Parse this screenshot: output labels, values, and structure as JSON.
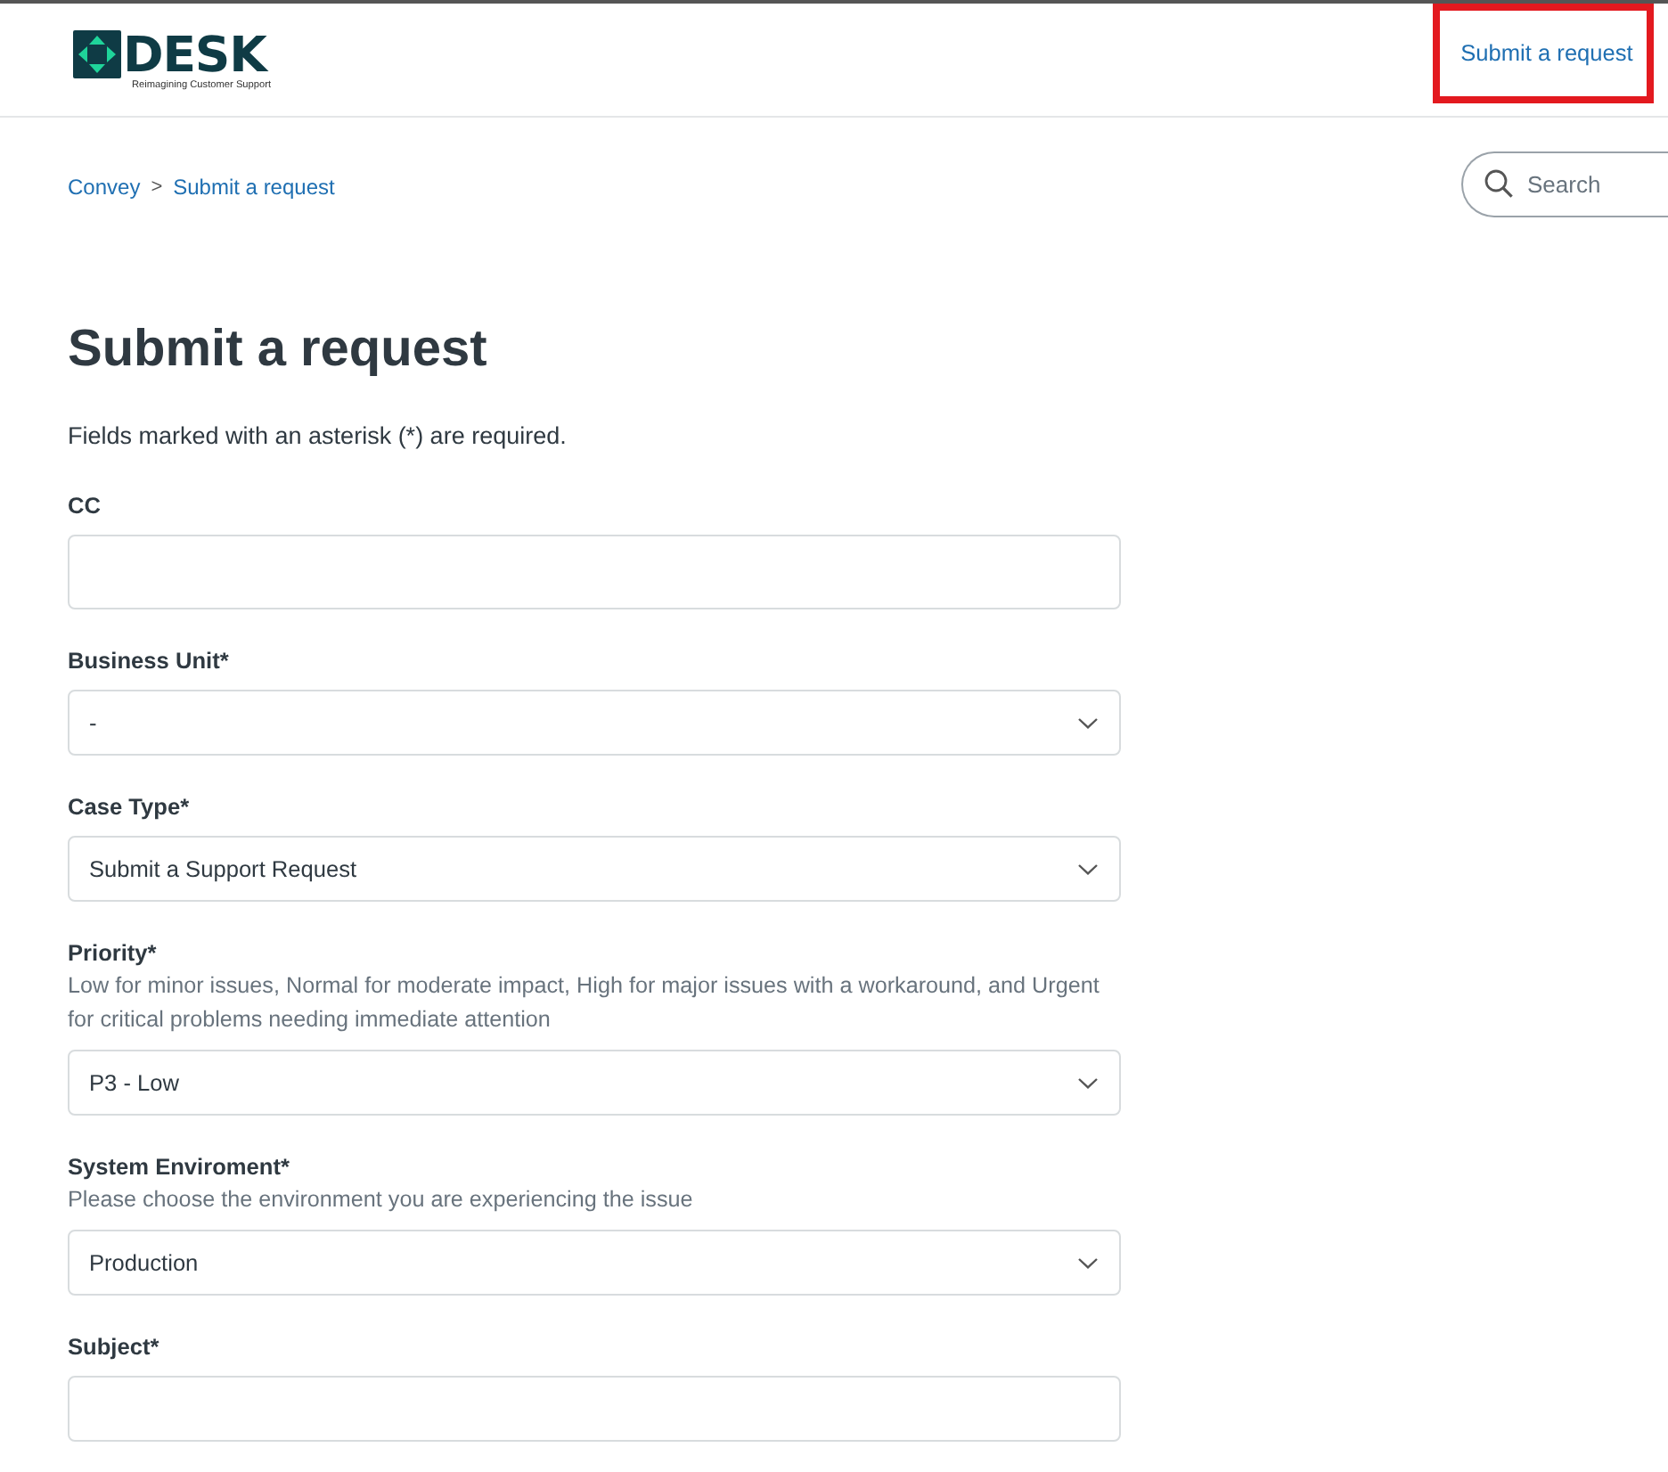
{
  "header": {
    "logo": {
      "wordmark": "DESK",
      "tagline": "Reimagining Customer Support"
    },
    "link": {
      "label": "Submit a request",
      "highlighted": true
    }
  },
  "breadcrumb": {
    "items": [
      "Convey",
      "Submit a request"
    ],
    "separator": ">"
  },
  "search": {
    "placeholder": "Search"
  },
  "page_title": "Submit a request",
  "required_note": "Fields marked with an asterisk (*) are required.",
  "fields": [
    {
      "kind": "multi",
      "label": "CC"
    },
    {
      "kind": "select",
      "label": "Business Unit*",
      "value": "-"
    },
    {
      "kind": "select",
      "label": "Case Type*",
      "value": "Submit a Support Request"
    },
    {
      "kind": "select",
      "label": "Priority*",
      "description": "Low for minor issues, Normal for moderate impact, High for major issues with a workaround, and Urgent for critical problems needing immediate attention",
      "value": "P3 - Low"
    },
    {
      "kind": "select",
      "label": "System Enviroment*",
      "description": "Please choose the environment you are experiencing the issue",
      "value": "Production"
    },
    {
      "kind": "text",
      "label": "Subject*"
    }
  ]
}
